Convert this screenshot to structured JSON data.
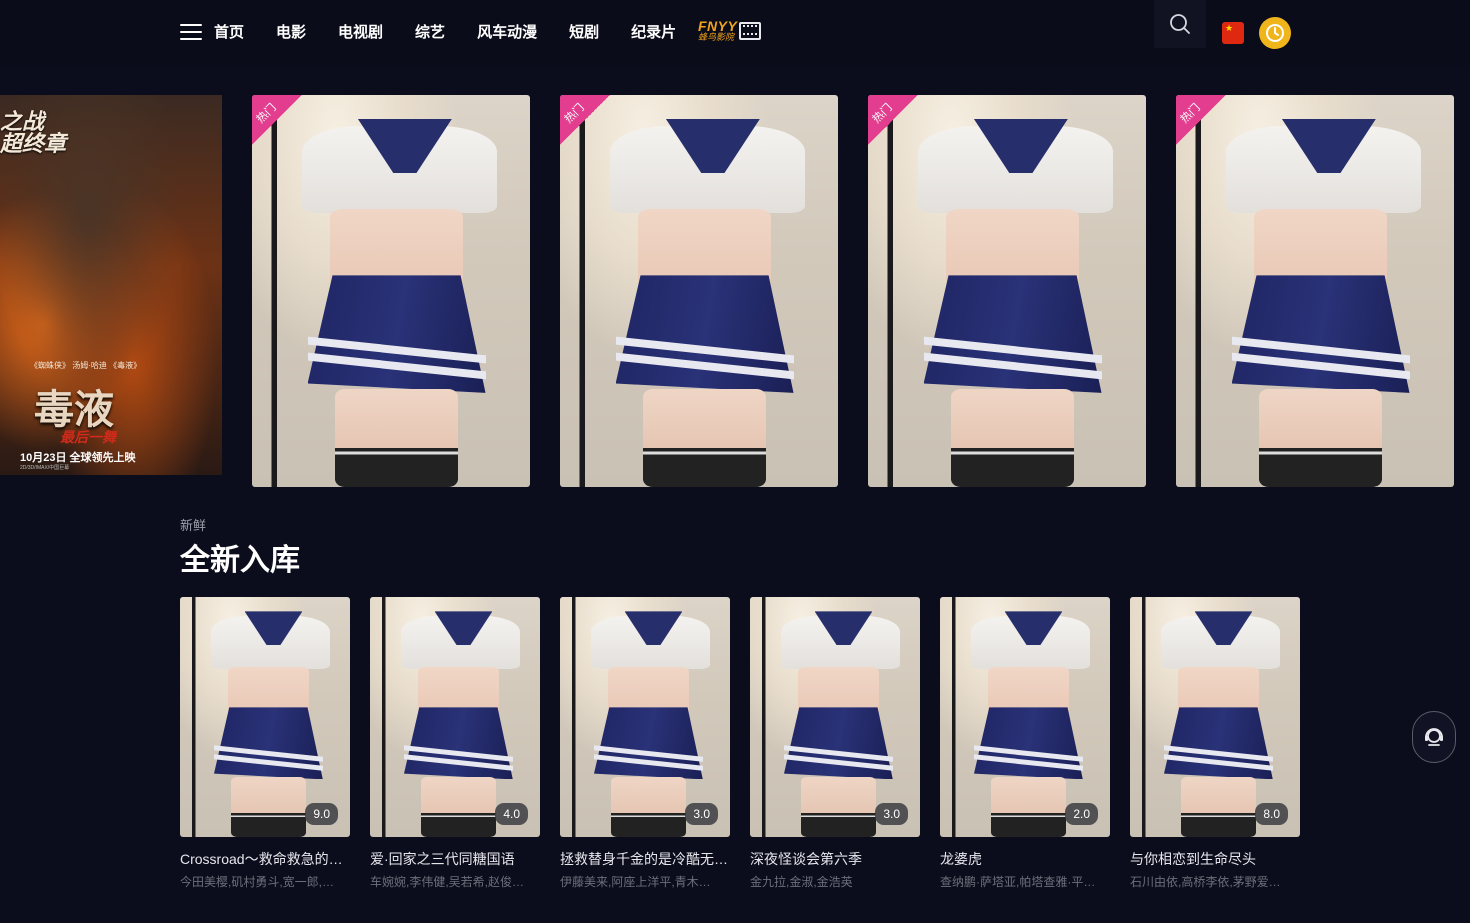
{
  "header": {
    "nav": [
      "首页",
      "电影",
      "电视剧",
      "综艺",
      "风车动漫",
      "短剧",
      "纪录片"
    ],
    "logo_text": "FNYY",
    "logo_sub": "蜂鸟影院",
    "icons": {
      "menu": "menu-icon",
      "search": "search-icon",
      "language": "china-flag-icon",
      "history": "clock-icon"
    }
  },
  "banner": {
    "left_poster": {
      "top_text": "之战\n超终章",
      "credit": "《蜘蛛侠》 汤姆·哈迪 《毒液》",
      "title": "毒液",
      "subtitle": "最后一舞",
      "date": "10月23日 全球领先上映",
      "small": "2D/3D/IMAX/中国巨幕"
    },
    "hot_label": "热门",
    "card_count": 4
  },
  "section": {
    "subtitle": "新鲜",
    "title": "全新入库",
    "items": [
      {
        "title": "Crossroad～救命救急的…",
        "cast": "今田美樱,矶村勇斗,宽一郎,…",
        "score": "9.0"
      },
      {
        "title": "爱·回家之三代同糖国语",
        "cast": "车婉婉,李伟健,吴若希,赵俊…",
        "score": "4.0"
      },
      {
        "title": "拯救替身千金的是冷酷无…",
        "cast": "伊藤美来,阿座上洋平,青木…",
        "score": "3.0"
      },
      {
        "title": "深夜怪谈会第六季",
        "cast": "金九拉,金淑,金浩英",
        "score": "3.0"
      },
      {
        "title": "龙婆虎",
        "cast": "查纳鹏·萨塔亚,帕塔查雅·平…",
        "score": "2.0"
      },
      {
        "title": "与你相恋到生命尽头",
        "cast": "石川由依,高桥李依,茅野爱…",
        "score": "8.0"
      }
    ]
  },
  "float_button": {
    "icon": "customer-service-icon"
  },
  "colors": {
    "background": "#0c0d1c",
    "hot_tag": "#e23d8e",
    "logo": "#f2a31b",
    "clock": "#f1b51c"
  }
}
